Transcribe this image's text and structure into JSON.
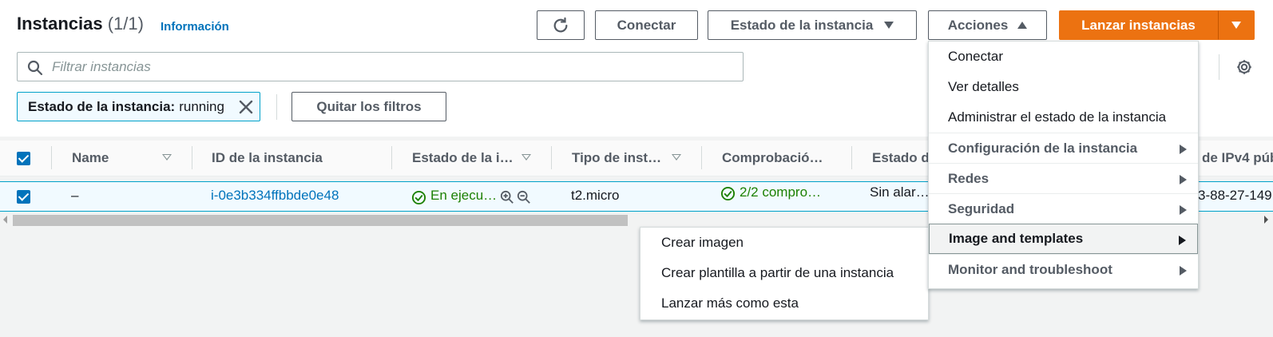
{
  "header": {
    "title": "Instancias",
    "count": "(1/1)",
    "info_link": "Información"
  },
  "toolbar": {
    "refresh_icon": "refresh-icon",
    "connect_label": "Conectar",
    "instance_state_label": "Estado de la instancia",
    "actions_label": "Acciones",
    "launch_label": "Lanzar instancias"
  },
  "search": {
    "placeholder": "Filtrar instancias",
    "value": ""
  },
  "filters": {
    "token_key": "Estado de la instancia:",
    "token_value": "running",
    "clear_label": "Quitar los filtros"
  },
  "table": {
    "columns": [
      "Name",
      "ID de la instancia",
      "Estado de la i…",
      "Tipo de inst…",
      "Comprobació…",
      "Estado de",
      "de IPv4 púb"
    ],
    "rows": [
      {
        "selected": true,
        "name": "–",
        "instance_id": "i-0e3b334ffbbde0e48",
        "state": "En ejecu…",
        "type": "t2.micro",
        "status_check": "2/2 compro…",
        "alarm_status": "Sin alar…",
        "public_ipv4": "3-88-27-149"
      }
    ]
  },
  "actions_menu": {
    "items": [
      "Conectar",
      "Ver detalles",
      "Administrar el estado de la instancia"
    ],
    "groups": [
      "Configuración de la instancia",
      "Redes",
      "Seguridad",
      "Image and templates",
      "Monitor and troubleshoot"
    ],
    "active_group": "Image and templates"
  },
  "submenu": {
    "items": [
      "Crear imagen",
      "Crear plantilla a partir de una instancia",
      "Lanzar más como esta"
    ]
  },
  "colors": {
    "accent": "#ec7211",
    "link": "#0073bb",
    "success": "#1d8102",
    "selected_row": "#f1faff"
  }
}
